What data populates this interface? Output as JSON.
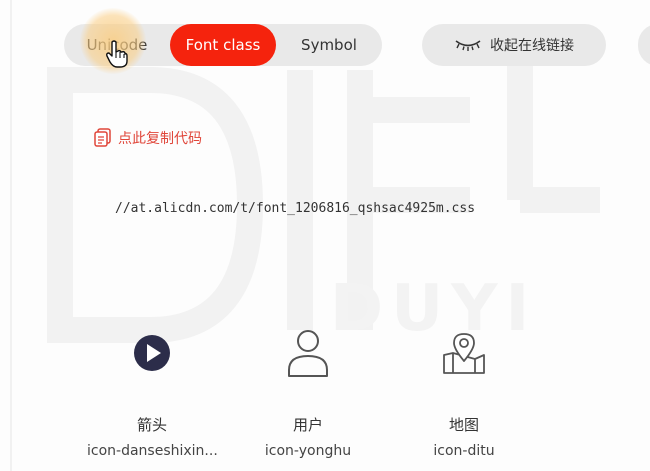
{
  "tabs": [
    {
      "label": "Unicode",
      "active": false
    },
    {
      "label": "Font class",
      "active": true
    },
    {
      "label": "Symbol",
      "active": false
    }
  ],
  "collapse_button": {
    "label": "收起在线链接",
    "icon": "closed-eye-icon"
  },
  "copy_code": {
    "label": "点此复制代码",
    "icon": "copy-icon"
  },
  "css_url": "//at.alicdn.com/t/font_1206816_qshsac4925m.css",
  "icons": [
    {
      "name": "箭头",
      "code": "icon-danseshixin...",
      "icon": "play-circle-icon"
    },
    {
      "name": "用户",
      "code": "icon-yonghu",
      "icon": "user-icon"
    },
    {
      "name": "地图",
      "code": "icon-ditu",
      "icon": "map-pin-icon"
    }
  ],
  "colors": {
    "accent": "#f5230d",
    "copy_link": "#e0463a",
    "pill_bg": "#e9e9e9"
  }
}
